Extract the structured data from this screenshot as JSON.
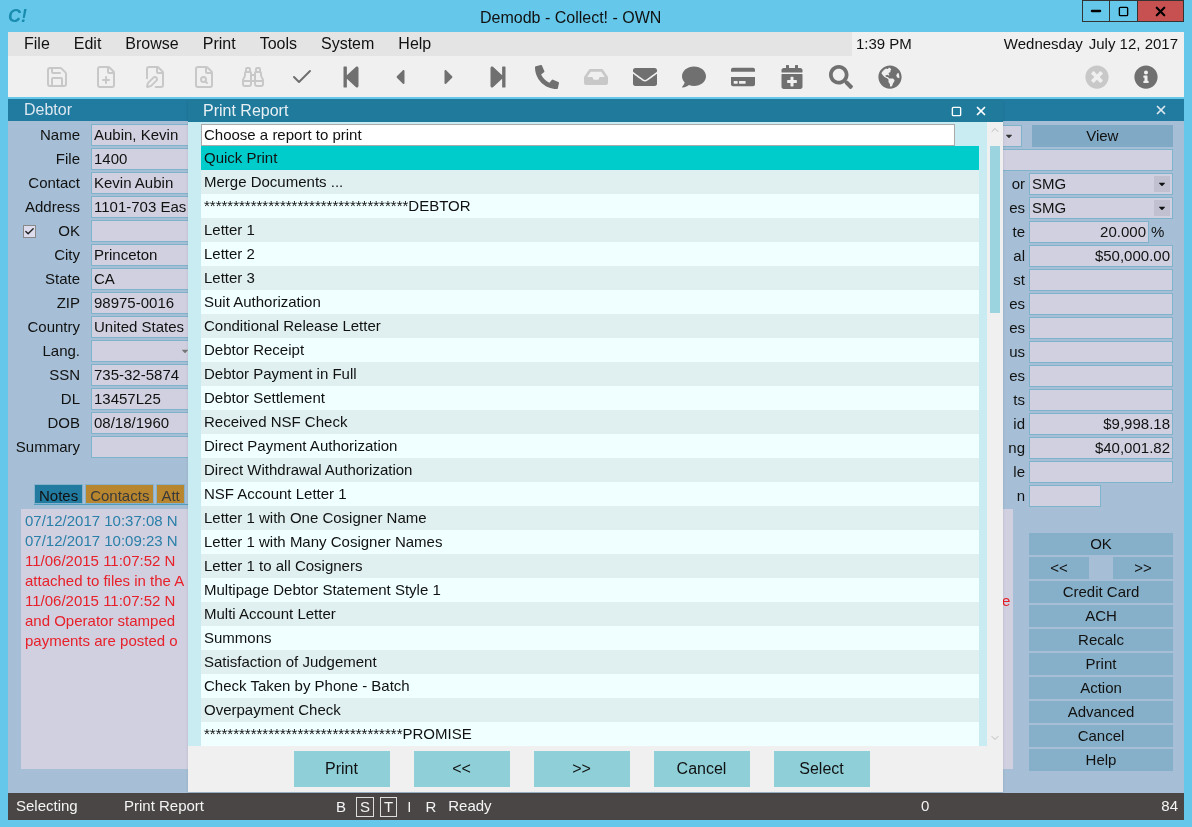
{
  "window": {
    "title": "Demodb - Collect! - OWN",
    "logo": "C!"
  },
  "menu": [
    "File",
    "Edit",
    "Browse",
    "Print",
    "Tools",
    "System",
    "Help"
  ],
  "clock": {
    "time": "1:39 PM",
    "day": "Wednesday",
    "date": "July 12, 2017"
  },
  "toolbar": [
    {
      "kind": "save",
      "disabled": true
    },
    {
      "kind": "file_add",
      "disabled": true
    },
    {
      "kind": "file_edit",
      "disabled": true
    },
    {
      "kind": "file_search",
      "disabled": true
    },
    {
      "kind": "binoculars",
      "disabled": true
    },
    {
      "kind": "check",
      "disabled": false
    },
    {
      "kind": "first",
      "disabled": false
    },
    {
      "kind": "prev",
      "disabled": false
    },
    {
      "kind": "next",
      "disabled": false
    },
    {
      "kind": "last",
      "disabled": false
    },
    {
      "kind": "phone",
      "disabled": false
    },
    {
      "kind": "tray",
      "disabled": true
    },
    {
      "kind": "mail",
      "disabled": false
    },
    {
      "kind": "chat",
      "disabled": false
    },
    {
      "kind": "card",
      "disabled": false
    },
    {
      "kind": "calendar",
      "disabled": false
    },
    {
      "kind": "search",
      "disabled": false
    },
    {
      "kind": "globe",
      "disabled": false
    },
    {
      "kind": "close",
      "disabled": true
    },
    {
      "kind": "info",
      "disabled": false
    }
  ],
  "debtor": {
    "title": "Debtor",
    "fields": [
      {
        "kind": "text",
        "label": "Name",
        "value": "Aubin, Kevin"
      },
      {
        "kind": "text",
        "label": "File",
        "value": "1400"
      },
      {
        "kind": "text",
        "label": "Contact",
        "value": "Kevin Aubin"
      },
      {
        "kind": "text",
        "label": "Address",
        "value": "1101-703 Eas"
      },
      {
        "kind": "checkbox",
        "label": "OK",
        "checked": true
      },
      {
        "kind": "text",
        "label": "City",
        "value": "Princeton"
      },
      {
        "kind": "text",
        "label": "State",
        "value": "CA"
      },
      {
        "kind": "text",
        "label": "ZIP",
        "value": "98975-0016"
      },
      {
        "kind": "text",
        "label": "Country",
        "value": "United States"
      },
      {
        "kind": "dropdown",
        "label": "Lang."
      },
      {
        "kind": "text",
        "label": "SSN",
        "value": "735-32-5874"
      },
      {
        "kind": "text",
        "label": "DL",
        "value": "13457L25"
      },
      {
        "kind": "text",
        "label": "DOB",
        "value": "08/18/1960"
      },
      {
        "kind": "text",
        "label": "Summary"
      }
    ],
    "right_rows": [
      {
        "kind": "combo_end",
        "button": "View"
      },
      {
        "kind": "wide"
      },
      {
        "kind": "dropdown",
        "label": "or",
        "value": "SMG"
      },
      {
        "kind": "dropdown",
        "label": "es",
        "value": "SMG"
      },
      {
        "kind": "percent",
        "label": "te",
        "value": "20.000",
        "unit": "%"
      },
      {
        "kind": "text",
        "label": "al",
        "value": "$50,000.00"
      },
      {
        "kind": "text",
        "label": "st"
      },
      {
        "kind": "text",
        "label": "es"
      },
      {
        "kind": "text",
        "label": "es"
      },
      {
        "kind": "text",
        "label": "us"
      },
      {
        "kind": "text",
        "label": "es"
      },
      {
        "kind": "text",
        "label": "ts"
      },
      {
        "kind": "text",
        "label": "id",
        "value": "$9,998.18"
      },
      {
        "kind": "text",
        "label": "ng",
        "value": "$40,001.82"
      },
      {
        "kind": "text",
        "label": "le"
      },
      {
        "kind": "short",
        "label": "n"
      }
    ],
    "tabs": [
      {
        "label": "Notes",
        "selected": true
      },
      {
        "label": "Contacts",
        "selected": false
      },
      {
        "label": "Att",
        "selected": false
      }
    ],
    "notes": [
      {
        "text": "07/12/2017 10:37:08 N",
        "color": "#2a7fa8"
      },
      {
        "text": "07/12/2017 10:09:23 N",
        "color": "#2a7fa8"
      },
      {
        "text": "11/06/2015 11:07:52 N",
        "color": "#e8202a"
      },
      {
        "text": "attached to files in the A",
        "color": "#e8202a"
      },
      {
        "text": "11/06/2015 11:07:52 N",
        "color": "#e8202a",
        "tail": "e"
      },
      {
        "text": "and Operator stamped",
        "color": "#e8202a"
      },
      {
        "text": "payments are posted o",
        "color": "#e8202a"
      }
    ],
    "actions": [
      {
        "kind": "full",
        "label": "OK"
      },
      {
        "kind": "half",
        "label": "<<"
      },
      {
        "kind": "half",
        "label": ">>"
      },
      {
        "kind": "full",
        "label": "Credit Card"
      },
      {
        "kind": "full",
        "label": "ACH"
      },
      {
        "kind": "full",
        "label": "Recalc"
      },
      {
        "kind": "full",
        "label": "Print"
      },
      {
        "kind": "full",
        "label": "Action"
      },
      {
        "kind": "full",
        "label": "Advanced"
      },
      {
        "kind": "full",
        "label": "Cancel"
      },
      {
        "kind": "full",
        "label": "Help"
      }
    ]
  },
  "dialog": {
    "title": "Print Report",
    "combo": "Choose a report to print",
    "reports": [
      {
        "label": "Quick Print",
        "selected": true
      },
      {
        "label": "Merge Documents ...",
        "selected": false
      },
      {
        "label": "***********************************DEBTOR",
        "selected": false
      },
      {
        "label": "Letter 1",
        "selected": false
      },
      {
        "label": "Letter 2",
        "selected": false
      },
      {
        "label": "Letter 3",
        "selected": false
      },
      {
        "label": "Suit Authorization",
        "selected": false
      },
      {
        "label": "Conditional Release Letter",
        "selected": false
      },
      {
        "label": "Debtor Receipt",
        "selected": false
      },
      {
        "label": "Debtor Payment in Full",
        "selected": false
      },
      {
        "label": "Debtor Settlement",
        "selected": false
      },
      {
        "label": "Received NSF Check",
        "selected": false
      },
      {
        "label": "Direct Payment Authorization",
        "selected": false
      },
      {
        "label": "Direct Withdrawal Authorization",
        "selected": false
      },
      {
        "label": "NSF Account Letter 1",
        "selected": false
      },
      {
        "label": "Letter 1 with One Cosigner Name",
        "selected": false
      },
      {
        "label": "Letter 1 with Many Cosigner Names",
        "selected": false
      },
      {
        "label": "Letter 1 to all Cosigners",
        "selected": false
      },
      {
        "label": "Multipage Debtor Statement Style 1",
        "selected": false
      },
      {
        "label": "Multi Account Letter",
        "selected": false
      },
      {
        "label": "Summons",
        "selected": false
      },
      {
        "label": "Satisfaction of Judgement",
        "selected": false
      },
      {
        "label": "Check Taken by Phone - Batch",
        "selected": false
      },
      {
        "label": "Overpayment Check",
        "selected": false
      },
      {
        "label": "**********************************PROMISE",
        "selected": false
      }
    ],
    "buttons": [
      "Print",
      "<<",
      ">>",
      "Cancel",
      "Select"
    ]
  },
  "status_bar": {
    "mode": "Selecting",
    "screen": "Print Report",
    "flags": [
      {
        "label": "B",
        "on": false
      },
      {
        "label": "S",
        "on": true
      },
      {
        "label": "T",
        "on": true
      },
      {
        "label": "I",
        "on": false
      },
      {
        "label": "R",
        "on": false
      }
    ],
    "state": "Ready",
    "count": "0",
    "total": "84"
  }
}
